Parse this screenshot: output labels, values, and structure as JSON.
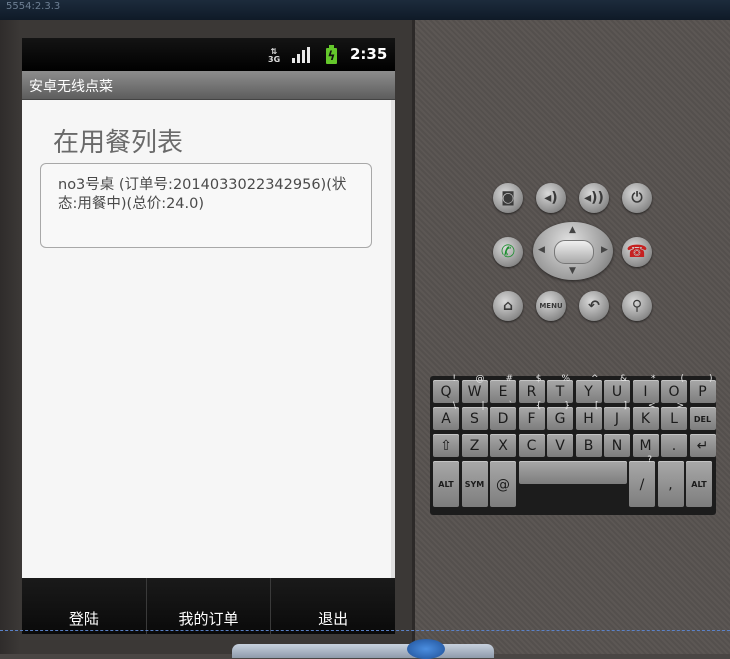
{
  "window": {
    "title": "5554:2.3.3"
  },
  "status_bar": {
    "network": "3G",
    "time": "2:35"
  },
  "app": {
    "title": "安卓无线点菜",
    "heading": "在用餐列表",
    "orders": [
      {
        "text": "no3号桌 (订单号:2014033022342956)(状态:用餐中)(总价:24.0)"
      }
    ],
    "bottom_buttons": [
      {
        "label": "登陆"
      },
      {
        "label": "我的订单"
      },
      {
        "label": "退出"
      }
    ]
  },
  "controls": {
    "top_row": [
      "camera-icon",
      "volume-down-icon",
      "volume-up-icon",
      "power-icon"
    ],
    "menu_label": "MENU"
  },
  "keyboard": {
    "row1": [
      [
        "Q",
        "!"
      ],
      [
        "W",
        "@"
      ],
      [
        "E",
        "#"
      ],
      [
        "R",
        "$"
      ],
      [
        "T",
        "%"
      ],
      [
        "Y",
        "^"
      ],
      [
        "U",
        "&"
      ],
      [
        "I",
        "*"
      ],
      [
        "O",
        "("
      ],
      [
        "P",
        ")"
      ]
    ],
    "row2": [
      [
        "A",
        "\\"
      ],
      [
        "S",
        "|"
      ],
      [
        "D",
        "`"
      ],
      [
        "F",
        "{"
      ],
      [
        "G",
        "}"
      ],
      [
        "H",
        "["
      ],
      [
        "J",
        "]"
      ],
      [
        "K",
        "<"
      ],
      [
        "L",
        ">"
      ],
      [
        "DEL",
        ""
      ]
    ],
    "row3": [
      [
        "⇧",
        ""
      ],
      [
        "Z",
        ""
      ],
      [
        "X",
        ""
      ],
      [
        "C",
        ""
      ],
      [
        "V",
        ""
      ],
      [
        "B",
        ""
      ],
      [
        "N",
        ""
      ],
      [
        "M",
        ""
      ],
      [
        ".",
        ""
      ],
      [
        "↵",
        ""
      ]
    ],
    "row4": [
      [
        "ALT",
        ""
      ],
      [
        "SYM",
        ""
      ],
      [
        "@",
        ""
      ],
      [
        "",
        ""
      ],
      [
        "/",
        "?"
      ],
      [
        ",",
        ""
      ],
      [
        "ALT",
        ""
      ]
    ]
  }
}
